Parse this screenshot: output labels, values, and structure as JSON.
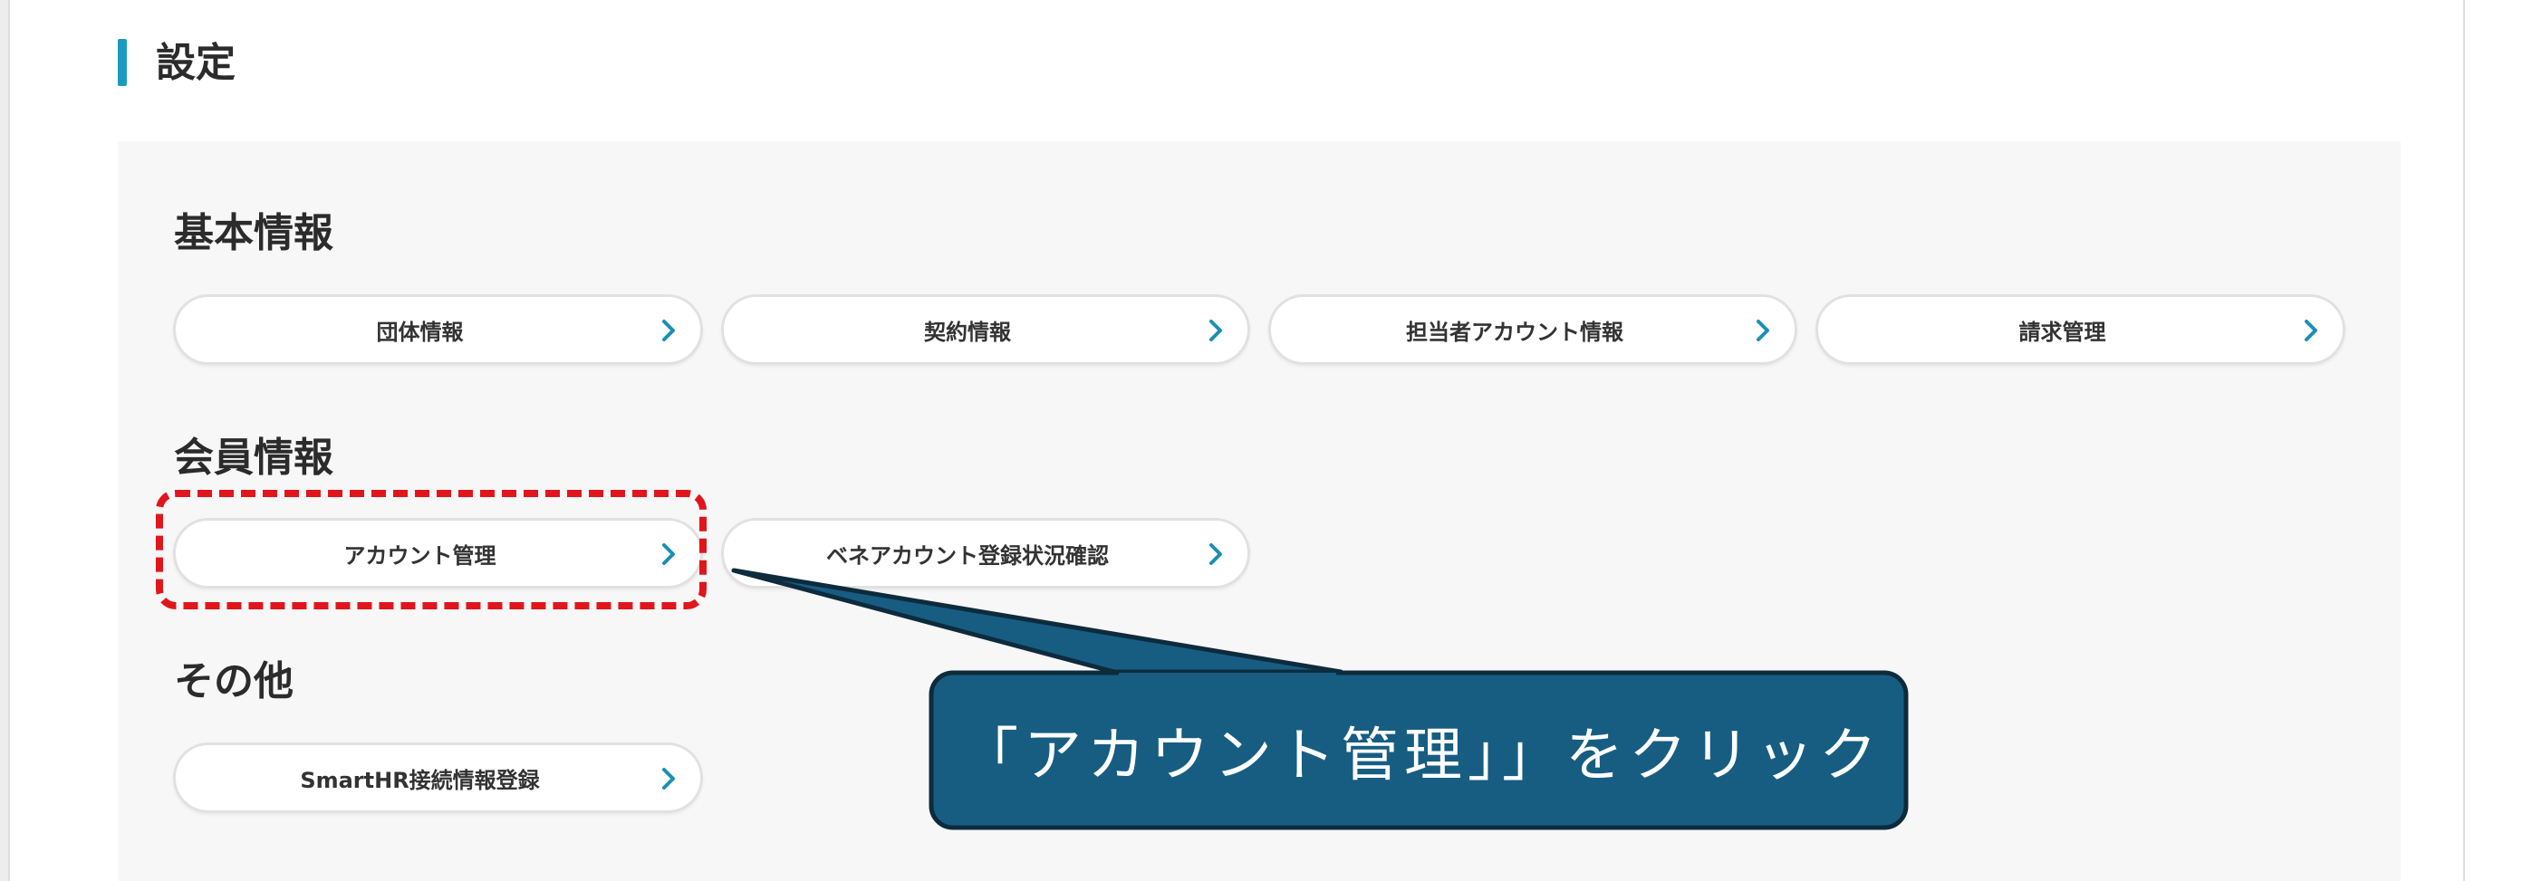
{
  "page": {
    "title": "設定"
  },
  "sections": [
    {
      "heading": "基本情報",
      "buttons": [
        "団体情報",
        "契約情報",
        "担当者アカウント情報",
        "請求管理"
      ]
    },
    {
      "heading": "会員情報",
      "buttons": [
        "アカウント管理",
        "ベネアカウント登録状況確認"
      ]
    },
    {
      "heading": "その他",
      "buttons": [
        "SmartHR接続情報登録"
      ]
    }
  ],
  "annotation": {
    "callout_text": "「アカウント管理」」をクリック",
    "highlight_color": "#e0161c",
    "callout_color": "#175d82"
  },
  "colors": {
    "accent": "#1b9ac0",
    "chevron": "#1b8fb3",
    "panel_bg": "#f7f7f7"
  },
  "icons": {
    "chevron": "chevron-right-icon"
  }
}
